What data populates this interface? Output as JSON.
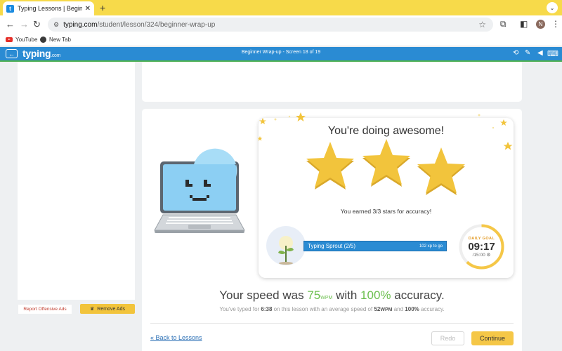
{
  "browser": {
    "tab_title": "Typing Lessons | Beginner Wr",
    "tab_close": "✕",
    "new_tab": "+",
    "url_domain": "typing.com",
    "url_path": "/student/lesson/324/beginner-wrap-up",
    "profile_initial": "N",
    "bookmarks": [
      {
        "label": "YouTube",
        "icon": "youtube-icon"
      },
      {
        "label": "New Tab",
        "icon": "globe-icon"
      }
    ]
  },
  "app": {
    "logo": "typing",
    "logo_suffix": ".com",
    "screen_title": "Beginner Wrap-up - Screen 18 of 19"
  },
  "sidebar": {
    "report_label": "Report Offensive Ads",
    "remove_label": "Remove Ads"
  },
  "results": {
    "headline": "You're doing awesome!",
    "stars_earned": 3,
    "stars_total": 3,
    "accuracy_text": "You earned 3/3 stars for accuracy!",
    "level_name": "Typing Sprout (2/5)",
    "xp_to_go": "102 xp to go",
    "daily_goal_label": "DAILY GOAL",
    "daily_goal_time": "09:17",
    "daily_goal_total": "/15:00",
    "daily_goal_progress": 0.62,
    "speed_prefix": "Your speed was",
    "speed_value": "75",
    "speed_unit": "WPM",
    "speed_mid": "with",
    "accuracy_value": "100%",
    "accuracy_suffix": "accuracy.",
    "summary_prefix": "You've typed for",
    "summary_time": "6:38",
    "summary_mid": "on this lesson with an average speed of",
    "summary_avg": "52",
    "summary_unit": "WPM",
    "summary_and": "and",
    "summary_acc": "100%",
    "summary_end": "accuracy."
  },
  "footer": {
    "back_link": "« Back to Lessons",
    "redo_label": "Redo",
    "continue_label": "Continue"
  },
  "colors": {
    "tabstrip": "#f7da4a",
    "header": "#2a8bd3",
    "accent_green": "#6bbf4e",
    "star_gold": "#f2c43c",
    "continue": "#f5c747"
  }
}
